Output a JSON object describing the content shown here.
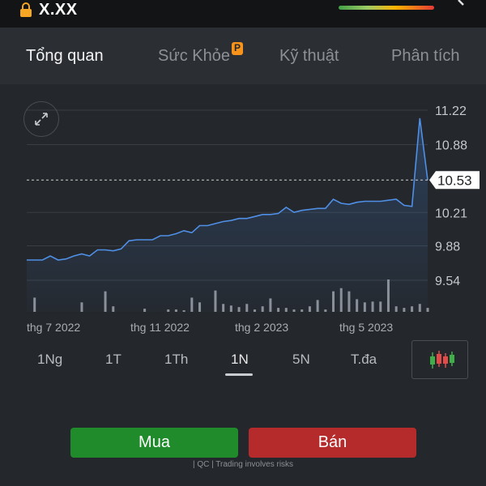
{
  "header": {
    "ticker": "X.XX"
  },
  "tabs": [
    {
      "label": "Tổng quan",
      "active": true
    },
    {
      "label": "Sức Khỏe",
      "active": false,
      "badge": "P"
    },
    {
      "label": "Kỹ thuật",
      "active": false
    },
    {
      "label": "Phân tích",
      "active": false
    }
  ],
  "chart_data": {
    "type": "area",
    "y_ticks": [
      "11.22",
      "10.88",
      "10.53",
      "10.21",
      "9.88",
      "9.54"
    ],
    "ylim": [
      9.54,
      11.22
    ],
    "current_price": "10.53",
    "x_labels": [
      "thg 7 2022",
      "thg 11 2022",
      "thg 2 2023",
      "thg 5 2023"
    ],
    "series": [
      {
        "values": [
          9.74,
          9.74,
          9.74,
          9.78,
          9.74,
          9.75,
          9.78,
          9.8,
          9.78,
          9.84,
          9.84,
          9.83,
          9.85,
          9.93,
          9.94,
          9.94,
          9.94,
          9.98,
          9.98,
          10.0,
          10.03,
          10.01,
          10.08,
          10.08,
          10.1,
          10.12,
          10.13,
          10.15,
          10.15,
          10.17,
          10.19,
          10.19,
          10.2,
          10.26,
          10.21,
          10.23,
          10.24,
          10.25,
          10.25,
          10.34,
          10.3,
          10.29,
          10.31,
          10.32,
          10.32,
          10.32,
          10.33,
          10.34,
          10.28,
          10.27,
          11.14,
          10.53
        ],
        "volume": [
          0,
          1.8,
          0,
          0,
          0,
          0,
          0,
          1.2,
          0,
          0,
          2.6,
          0.7,
          0,
          0,
          0,
          0.4,
          0,
          0,
          0.3,
          0.3,
          0.2,
          1.8,
          1.2,
          0,
          2.7,
          1.0,
          0.8,
          0.6,
          1.0,
          0.3,
          0.7,
          1.7,
          0.5,
          0.5,
          0.3,
          0.3,
          0.7,
          1.5,
          0.3,
          2.6,
          3.0,
          2.6,
          1.6,
          1.2,
          1.3,
          1.3,
          4.1,
          0.7,
          0.5,
          0.7,
          1.0,
          0.5
        ]
      }
    ],
    "colors": {
      "line": "#4f8fe6",
      "volume": "#8e9298",
      "grid": "#3a3e44"
    }
  },
  "ranges": [
    {
      "label": "1Ng",
      "active": false
    },
    {
      "label": "1T",
      "active": false
    },
    {
      "label": "1Th",
      "active": false
    },
    {
      "label": "1N",
      "active": true
    },
    {
      "label": "5N",
      "active": false
    },
    {
      "label": "T.đa",
      "active": false
    }
  ],
  "actions": {
    "buy": "Mua",
    "sell": "Bán"
  },
  "colors": {
    "buy": "#1f8b2a",
    "sell": "#b52a2b"
  },
  "disclaimer": "| QC | Trading involves risks"
}
